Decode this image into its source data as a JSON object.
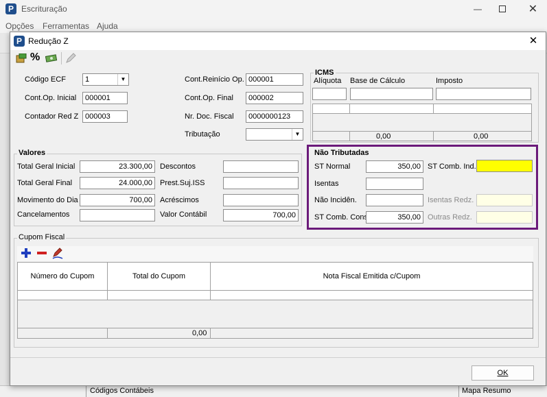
{
  "main_window": {
    "title": "Escrituração",
    "menu": [
      "Opções",
      "Ferramentas",
      "Ajuda"
    ],
    "status_left": "Códigos Contábeis",
    "status_right": "Mapa Resumo"
  },
  "dialog": {
    "title": "Redução Z",
    "fields": {
      "codigo_ecf": {
        "label": "Código ECF",
        "value": "1"
      },
      "cont_op_inicial": {
        "label": "Cont.Op. Inicial",
        "value": "000001"
      },
      "contador_red_z": {
        "label": "Contador Red Z",
        "value": "000003"
      },
      "cont_reinicio_op": {
        "label": "Cont.Reinício Op.",
        "value": "000001"
      },
      "cont_op_final": {
        "label": "Cont.Op. Final",
        "value": "000002"
      },
      "nr_doc_fiscal": {
        "label": "Nr. Doc. Fiscal",
        "value": "0000000123"
      },
      "tributacao": {
        "label": "Tributação",
        "value": ""
      }
    },
    "icms": {
      "legend": "ICMS",
      "aliquota_label": "Alíquota",
      "base_label": "Base de Cálculo",
      "imposto_label": "Imposto",
      "total_base": "0,00",
      "total_imposto": "0,00"
    },
    "valores": {
      "legend": "Valores",
      "total_geral_inicial": {
        "label": "Total Geral Inicial",
        "value": "23.300,00"
      },
      "total_geral_final": {
        "label": "Total Geral Final",
        "value": "24.000,00"
      },
      "movimento_dia": {
        "label": "Movimento do Dia",
        "value": "700,00"
      },
      "cancelamentos": {
        "label": "Cancelamentos",
        "value": ""
      },
      "descontos": {
        "label": "Descontos",
        "value": ""
      },
      "prest_suj_iss": {
        "label": "Prest.Suj.ISS",
        "value": ""
      },
      "acrescimos": {
        "label": "Acréscimos",
        "value": ""
      },
      "valor_contabil": {
        "label": "Valor Contábil",
        "value": "700,00"
      }
    },
    "nao_tributadas": {
      "legend": "Não Tributadas",
      "st_normal": {
        "label": "ST Normal",
        "value": "350,00"
      },
      "isentas": {
        "label": "Isentas",
        "value": ""
      },
      "nao_incid": {
        "label": "Não Incidên.",
        "value": ""
      },
      "st_comb_cons": {
        "label": "ST Comb. Cons",
        "value": "350,00"
      },
      "st_comb_ind": {
        "label": "ST Comb. Ind.",
        "value": ""
      },
      "isentas_redz": {
        "label": "Isentas Redz.",
        "value": ""
      },
      "outras_redz": {
        "label": "Outras Redz.",
        "value": ""
      }
    },
    "cupom": {
      "legend": "Cupom Fiscal",
      "columns": [
        "Número do Cupom",
        "Total do Cupom",
        "Nota Fiscal Emitida c/Cupom"
      ],
      "total": "0,00"
    },
    "ok_label": "OK",
    "colors": {
      "highlight_border": "#6b1a7a",
      "yellow_field": "#ffff00",
      "disabled_field": "#ffffe6"
    }
  }
}
